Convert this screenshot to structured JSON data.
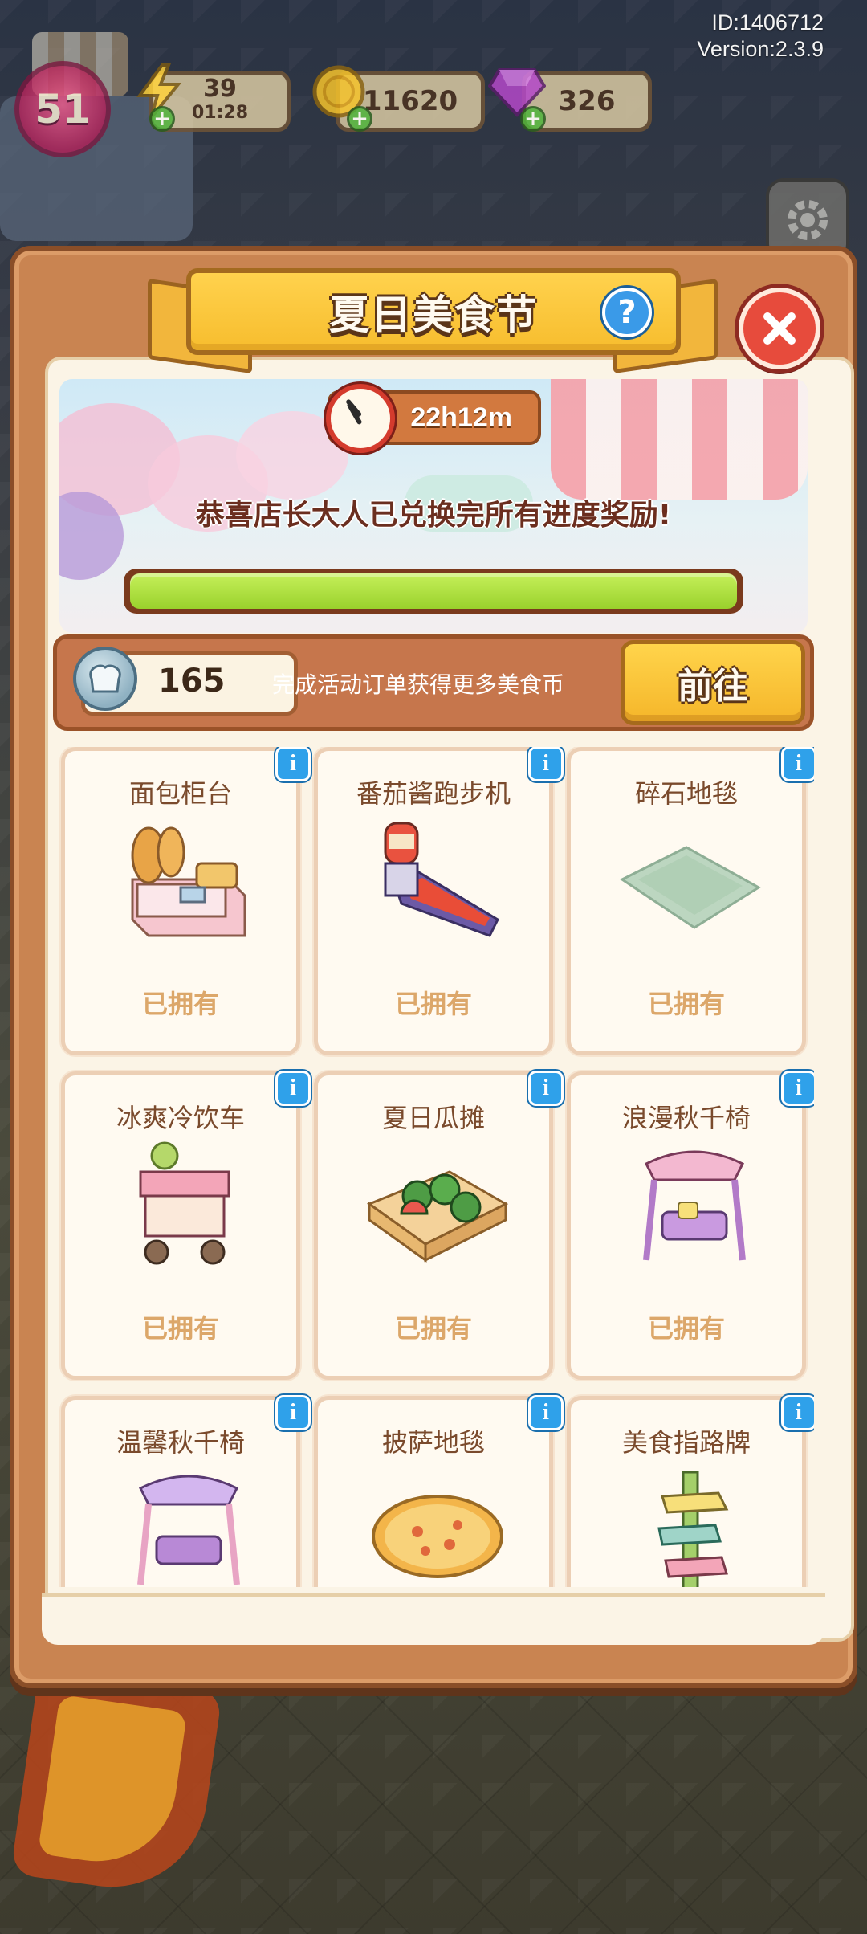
{
  "hud": {
    "id_text": "ID:1406712",
    "version_text": "Version:2.3.9",
    "level": "51",
    "energy": "39",
    "energy_timer": "01:28",
    "coins": "11620",
    "gems": "326"
  },
  "modal": {
    "title": "夏日美食节",
    "help_icon": "?",
    "timer": "22h12m",
    "congrats_text": "恭喜店长大人已兑换完所有进度奖励!",
    "progress": 1.0,
    "currency": {
      "count": "165",
      "description": "完成活动订单获得更多美食币",
      "go_label": "前往"
    },
    "items": [
      {
        "name": "面包柜台",
        "status": "已拥有",
        "icon": "bread-counter-icon"
      },
      {
        "name": "番茄酱跑步机",
        "status": "已拥有",
        "icon": "ketchup-treadmill-icon"
      },
      {
        "name": "碎石地毯",
        "status": "已拥有",
        "icon": "gravel-rug-icon"
      },
      {
        "name": "冰爽冷饮车",
        "status": "已拥有",
        "icon": "drink-cart-icon"
      },
      {
        "name": "夏日瓜摊",
        "status": "已拥有",
        "icon": "melon-stand-icon"
      },
      {
        "name": "浪漫秋千椅",
        "status": "已拥有",
        "icon": "pink-swing-icon"
      },
      {
        "name": "温馨秋千椅",
        "status": "",
        "icon": "purple-swing-icon"
      },
      {
        "name": "披萨地毯",
        "status": "",
        "icon": "pizza-rug-icon"
      },
      {
        "name": "美食指路牌",
        "status": "",
        "icon": "food-signpost-icon"
      }
    ],
    "info_icon": "i"
  },
  "colors": {
    "frame": "#c98451",
    "ribbon": "#f7bd2e",
    "close": "#e74b3c",
    "info": "#2fa1ea",
    "progress_fill": "#9ad12c",
    "owned_text": "#dca76a"
  }
}
